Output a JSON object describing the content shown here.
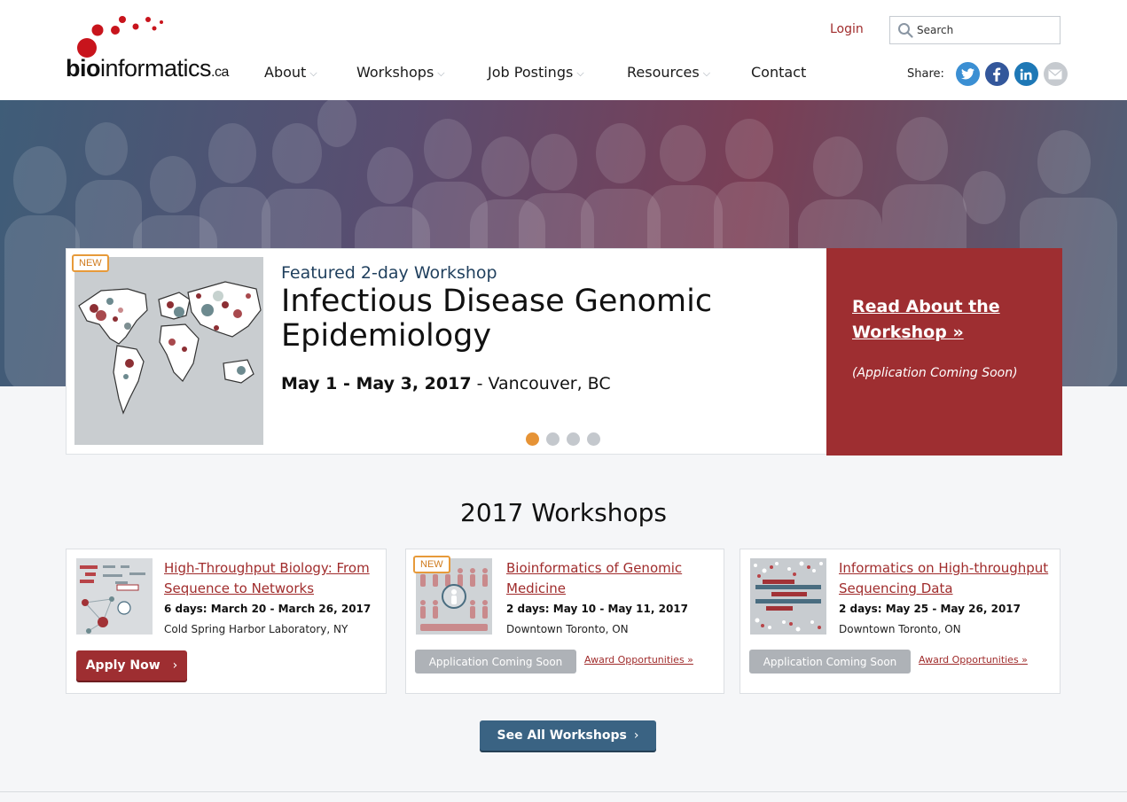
{
  "header": {
    "logo": {
      "prefix": "bio",
      "main": "informatics",
      "tld": ".ca"
    },
    "login_label": "Login",
    "search": {
      "placeholder": "Search",
      "icon": "search-icon"
    },
    "nav": [
      {
        "label": "About",
        "has_dropdown": true
      },
      {
        "label": "Workshops",
        "has_dropdown": true
      },
      {
        "label": "Job Postings",
        "has_dropdown": true
      },
      {
        "label": "Resources",
        "has_dropdown": true
      },
      {
        "label": "Contact",
        "has_dropdown": false
      }
    ],
    "share": {
      "label": "Share:",
      "networks": [
        {
          "name": "twitter",
          "color": "#3b8fd3",
          "icon": "twitter-icon"
        },
        {
          "name": "facebook",
          "color": "#33579b",
          "icon": "facebook-icon"
        },
        {
          "name": "linkedin",
          "color": "#1e78b6",
          "icon": "linkedin-icon"
        },
        {
          "name": "email",
          "color": "#c6cacf",
          "icon": "mail-icon"
        }
      ]
    }
  },
  "featured": {
    "badge": "NEW",
    "eyebrow": "Featured 2-day Workshop",
    "title": "Infectious Disease Genomic Epidemiology",
    "dates": "May 1 - May 3, 2017",
    "separator": " - ",
    "location": "Vancouver, BC",
    "cta_label": "Read About the Workshop »",
    "cta_note": "(Application Coming Soon)",
    "slides_total": 4,
    "active_slide": 1
  },
  "workshops": {
    "section_title": "2017 Workshops",
    "cards": [
      {
        "title": "High-Throughput Biology: From Sequence to Networks",
        "dates": "6 days: March 20 - March 26, 2017",
        "location": "Cold Spring Harbor Laboratory, NY",
        "button_label": "Apply Now",
        "button_state": "open"
      },
      {
        "badge": "NEW",
        "title": "Bioinformatics of Genomic Medicine",
        "dates": "2 days: May 10 - May 11, 2017",
        "location": "Downtown Toronto, ON",
        "button_label": "Application Coming Soon",
        "award_label": "Award Opportunities »",
        "button_state": "soon"
      },
      {
        "title": "Informatics on High-throughput Sequencing Data",
        "dates": "2 days: May 25 - May 26, 2017",
        "location": "Downtown Toronto, ON",
        "button_label": "Application Coming Soon",
        "award_label": "Award Opportunities »",
        "button_state": "soon"
      }
    ],
    "see_all_label": "See All Workshops"
  },
  "colors": {
    "brand_red": "#9e2e31",
    "link_red": "#a02c2c",
    "accent_orange": "#e69336",
    "primary_blue": "#3a6383",
    "disabled_gray": "#aeb2b7"
  }
}
